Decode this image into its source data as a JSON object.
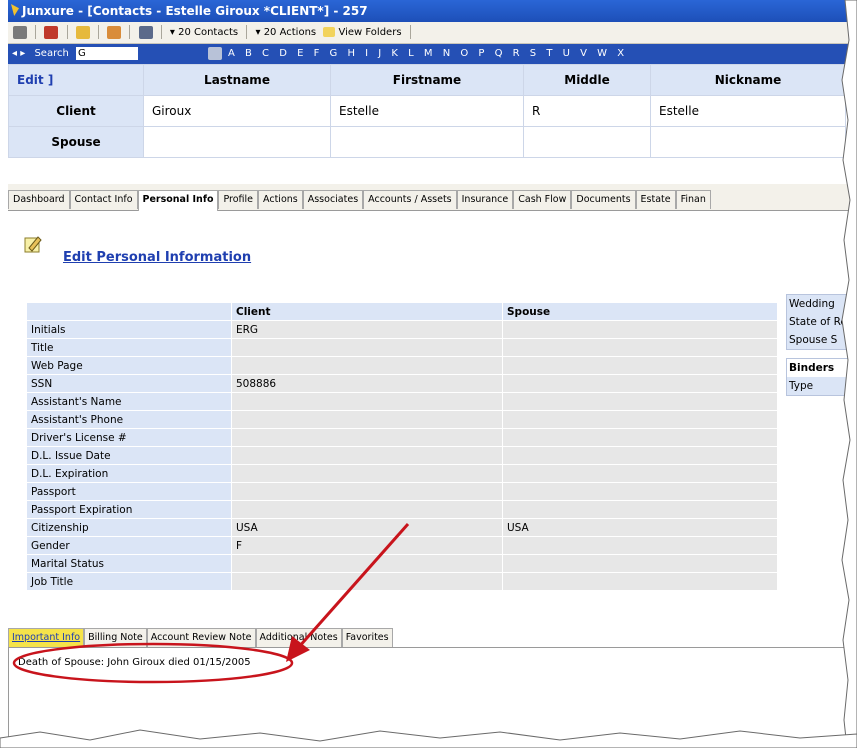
{
  "window": {
    "title": "Junxure - [Contacts - Estelle Giroux *CLIENT*] - 257"
  },
  "toolbar": {
    "contacts": "20 Contacts",
    "actions": "20 Actions",
    "folders": "View Folders"
  },
  "search": {
    "label": "Search",
    "value": "G",
    "letters": "A B C D E F G H I J K L M N O P Q R S T U V W X"
  },
  "header": {
    "edit": "Edit ]",
    "cols": [
      "Lastname",
      "Firstname",
      "Middle",
      "Nickname"
    ],
    "client": {
      "label": "Client",
      "values": [
        "Giroux",
        "Estelle",
        "R",
        "Estelle"
      ]
    },
    "spouse": {
      "label": "Spouse",
      "values": [
        "",
        "",
        "",
        ""
      ]
    }
  },
  "tabs": [
    "Dashboard",
    "Contact Info",
    "Personal Info",
    "Profile",
    "Actions",
    "Associates",
    "Accounts / Assets",
    "Insurance",
    "Cash Flow",
    "Documents",
    "Estate",
    "Finan"
  ],
  "edit_link": "Edit Personal Information",
  "personal": {
    "col_client": "Client",
    "col_spouse": "Spouse",
    "rows": [
      {
        "label": "Initials",
        "client": "ERG",
        "spouse": ""
      },
      {
        "label": "Title",
        "client": "",
        "spouse": ""
      },
      {
        "label": "Web Page",
        "client": "",
        "spouse": ""
      },
      {
        "label": "SSN",
        "client": "508886",
        "spouse": ""
      },
      {
        "label": "Assistant's Name",
        "client": "",
        "spouse": ""
      },
      {
        "label": "Assistant's Phone",
        "client": "",
        "spouse": ""
      },
      {
        "label": "Driver's License #",
        "client": "",
        "spouse": ""
      },
      {
        "label": "D.L. Issue Date",
        "client": "",
        "spouse": ""
      },
      {
        "label": "D.L. Expiration",
        "client": "",
        "spouse": ""
      },
      {
        "label": "Passport",
        "client": "",
        "spouse": ""
      },
      {
        "label": "Passport Expiration",
        "client": "",
        "spouse": ""
      },
      {
        "label": "Citizenship",
        "client": "USA",
        "spouse": "USA"
      },
      {
        "label": "Gender",
        "client": "F",
        "spouse": ""
      },
      {
        "label": "Marital Status",
        "client": "",
        "spouse": ""
      },
      {
        "label": "Job Title",
        "client": "",
        "spouse": ""
      }
    ]
  },
  "right_panel": {
    "items": [
      "Wedding",
      "State of Re",
      "Spouse S"
    ],
    "binders": "Binders",
    "type": "Type"
  },
  "bottom_tabs": [
    "Important Info",
    "Billing Note",
    "Account Review Note",
    "Additional Notes",
    "Favorites"
  ],
  "note": "Death of Spouse:  John Giroux died 01/15/2005",
  "colors": {
    "title_bar": "#1d4fb8",
    "label_bg": "#dbe5f6",
    "annotation": "#c8141c",
    "active_tab": "#f5e34a"
  }
}
